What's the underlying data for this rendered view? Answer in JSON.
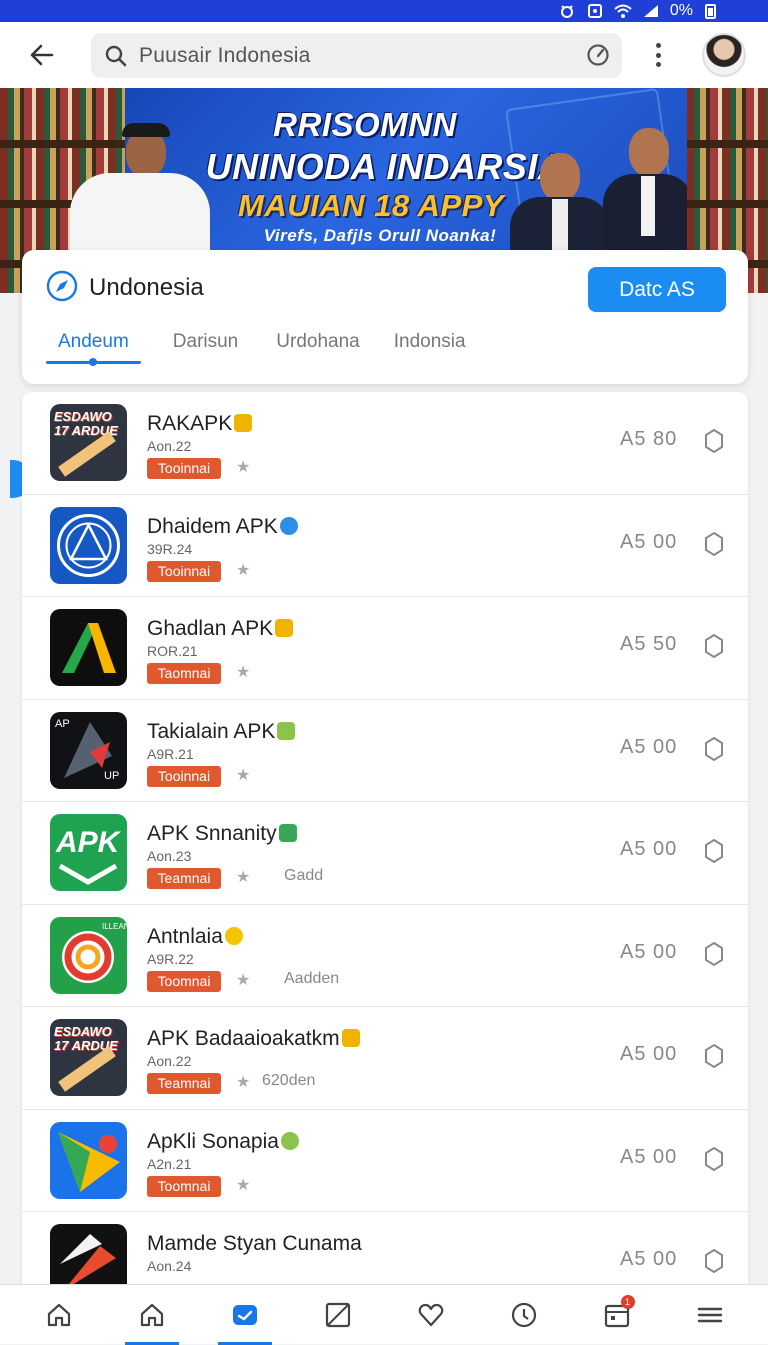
{
  "status_bar": {
    "battery": "0%"
  },
  "search": {
    "query": "Puusair Indonesia"
  },
  "banner": {
    "line1": "RRISOMNN",
    "line2": "UNINODA INDARSIA",
    "line3": "MAUIAN 18 APPY",
    "line4": "Virefs, Dafjls Orull Noanka!"
  },
  "card": {
    "title": "Undonesia",
    "cta": "Datc AS",
    "tabs": [
      "Andeum",
      "Darisun",
      "Urdohana",
      "Indonsia"
    ],
    "active_tab": "Andeum"
  },
  "apps": [
    {
      "name": "RAKAPK",
      "version": "Aon.22",
      "tag": "Tooinnai",
      "extra": "",
      "price": "A5 80",
      "badge_color": "#f0b400"
    },
    {
      "name": "Dhaidem APK",
      "version": "39R.24",
      "tag": "Tooinnai",
      "extra": "",
      "price": "A5 00",
      "badge_color": "#2d8de8"
    },
    {
      "name": "Ghadlan APK",
      "version": "ROR.21",
      "tag": "Taomnai",
      "extra": "",
      "price": "A5 50",
      "badge_color": "#f0b400"
    },
    {
      "name": "Takialain APK",
      "version": "A9R.21",
      "tag": "Tooinnai",
      "extra": "",
      "price": "A5 00",
      "badge_color": "#8cc34a"
    },
    {
      "name": "APK Snnanity",
      "version": "Aon.23",
      "tag": "Teamnai",
      "extra": "Gadd",
      "price": "A5 00",
      "badge_color": "#3aa657"
    },
    {
      "name": "Antnlaia",
      "version": "A9R.22",
      "tag": "Toomnai",
      "extra": "Aadden",
      "price": "A5 00",
      "badge_color": "#f5c400"
    },
    {
      "name": "APK Badaaioakatkm",
      "version": "Aon.22",
      "tag": "Teamnai",
      "extra": "620den",
      "price": "A5 00",
      "badge_color": "#f0b400"
    },
    {
      "name": "ApKli Sonapia",
      "version": "A2n.21",
      "tag": "Toomnai",
      "extra": "",
      "price": "A5 00",
      "badge_color": "#8cc34a"
    },
    {
      "name": "Mamde Styan Cunama",
      "version": "Aon.24",
      "tag": "",
      "extra": "",
      "price": "A5 00",
      "badge_color": ""
    }
  ],
  "icon_texts": {
    "app1": "ESDAWO 17 ARDUE",
    "app4_top": "AP",
    "app4_bottom": "UP",
    "app5": "APK",
    "app6": "ILLEAN",
    "app7": "ESDAWO 17 ARDUE"
  },
  "bottom_nav": {
    "items": [
      "home-outline-icon",
      "home-icon",
      "inbox-icon",
      "image-icon",
      "heart-icon",
      "clock-icon",
      "calendar-icon",
      "menu-icon"
    ],
    "active_index": 2,
    "badge": "1"
  },
  "colors": {
    "status_bar": "#1f3fd6",
    "accent": "#1a78e6",
    "cta": "#1a8cf2",
    "tag": "#e0592e"
  }
}
